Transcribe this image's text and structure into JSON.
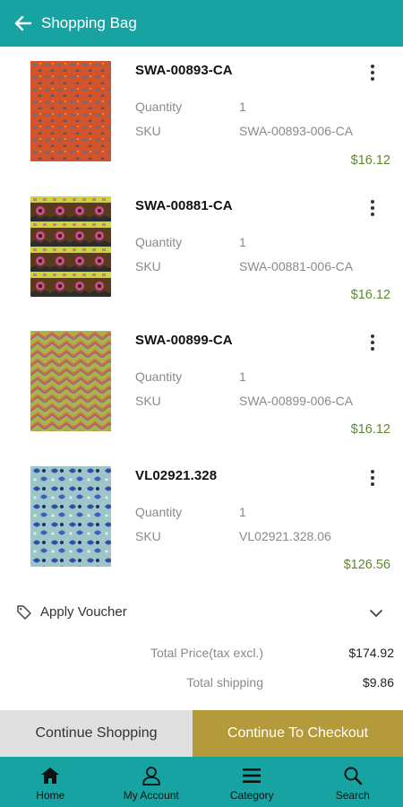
{
  "header": {
    "title": "Shopping Bag"
  },
  "items": [
    {
      "title": "SWA-00893-CA",
      "quantity_label": "Quantity",
      "quantity": "1",
      "sku_label": "SKU",
      "sku": "SWA-00893-006-CA",
      "price": "$16.12"
    },
    {
      "title": "SWA-00881-CA",
      "quantity_label": "Quantity",
      "quantity": "1",
      "sku_label": "SKU",
      "sku": "SWA-00881-006-CA",
      "price": "$16.12"
    },
    {
      "title": "SWA-00899-CA",
      "quantity_label": "Quantity",
      "quantity": "1",
      "sku_label": "SKU",
      "sku": "SWA-00899-006-CA",
      "price": "$16.12"
    },
    {
      "title": "VL02921.328",
      "quantity_label": "Quantity",
      "quantity": "1",
      "sku_label": "SKU",
      "sku": "VL02921.328.06",
      "price": "$126.56"
    }
  ],
  "voucher": {
    "label": "Apply Voucher"
  },
  "totals": [
    {
      "label": "Total Price(tax excl.)",
      "value": "$174.92"
    },
    {
      "label": "Total shipping",
      "value": "$9.86"
    }
  ],
  "actions": {
    "continue_shopping": "Continue Shopping",
    "checkout": "Continue To Checkout"
  },
  "nav": [
    {
      "label": "Home",
      "icon": "home-icon"
    },
    {
      "label": "My Account",
      "icon": "account-icon"
    },
    {
      "label": "Category",
      "icon": "category-icon"
    },
    {
      "label": "Search",
      "icon": "search-icon"
    }
  ],
  "colors": {
    "primary": "#16a3a1",
    "checkout": "#b49a3a",
    "price": "#5c8a2a"
  }
}
